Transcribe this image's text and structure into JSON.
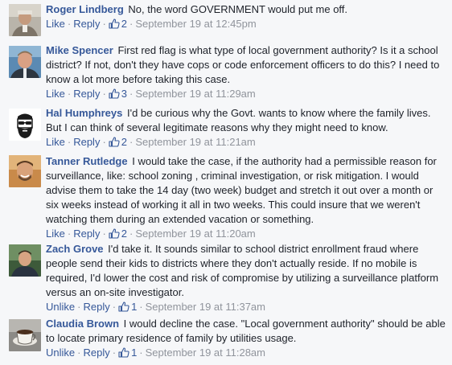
{
  "comments": [
    {
      "author": "Roger Lindberg",
      "text": "No, the word GOVERNMENT would put me off.",
      "like_label": "Like",
      "reply_label": "Reply",
      "likes": "2",
      "timestamp": "September 19 at 12:45pm",
      "avatar_icon": "roger-avatar"
    },
    {
      "author": "Mike Spencer",
      "text": "First red flag is what type of local government authority? Is it a school district? If not, don't they have cops or code enforcement officers to do this? I need to know a lot more before taking this case.",
      "like_label": "Like",
      "reply_label": "Reply",
      "likes": "3",
      "timestamp": "September 19 at 11:29am",
      "avatar_icon": "mike-avatar"
    },
    {
      "author": "Hal Humphreys",
      "text": "I'd be curious why the Govt. wants to know where the family lives. But I can think of several legitimate reasons why they might need to know.",
      "like_label": "Like",
      "reply_label": "Reply",
      "likes": "2",
      "timestamp": "September 19 at 11:21am",
      "avatar_icon": "hal-avatar"
    },
    {
      "author": "Tanner Rutledge",
      "text": "I would take the case, if the authority had a permissible reason for surveillance, like: school zoning , criminal investigation, or risk mitigation. I would advise them to take the 14 day (two week) budget and stretch it out over a month or six weeks instead of working it all in two weeks. This could insure that we weren't watching them during an extended vacation or something.",
      "like_label": "Like",
      "reply_label": "Reply",
      "likes": "2",
      "timestamp": "September 19 at 11:20am",
      "avatar_icon": "tanner-avatar"
    },
    {
      "author": "Zach Grove",
      "text": "I'd take it. It sounds similar to school district enrollment fraud where people send their kids to districts where they don't actually reside. If no mobile is required, I'd lower the cost and risk of compromise by utilizing a surveillance platform versus an on-site investigator.",
      "like_label": "Unlike",
      "reply_label": "Reply",
      "likes": "1",
      "timestamp": "September 19 at 11:37am",
      "avatar_icon": "zach-avatar"
    },
    {
      "author": "Claudia Brown",
      "text": "I would decline the case. \"Local government authority\" should be able to locate primary residence of family by utilities usage.",
      "like_label": "Unlike",
      "reply_label": "Reply",
      "likes": "1",
      "timestamp": "September 19 at 11:28am",
      "avatar_icon": "claudia-avatar"
    }
  ],
  "colors": {
    "link": "#365899",
    "meta": "#90949c",
    "text": "#1d2129",
    "background": "#f6f7f9"
  }
}
